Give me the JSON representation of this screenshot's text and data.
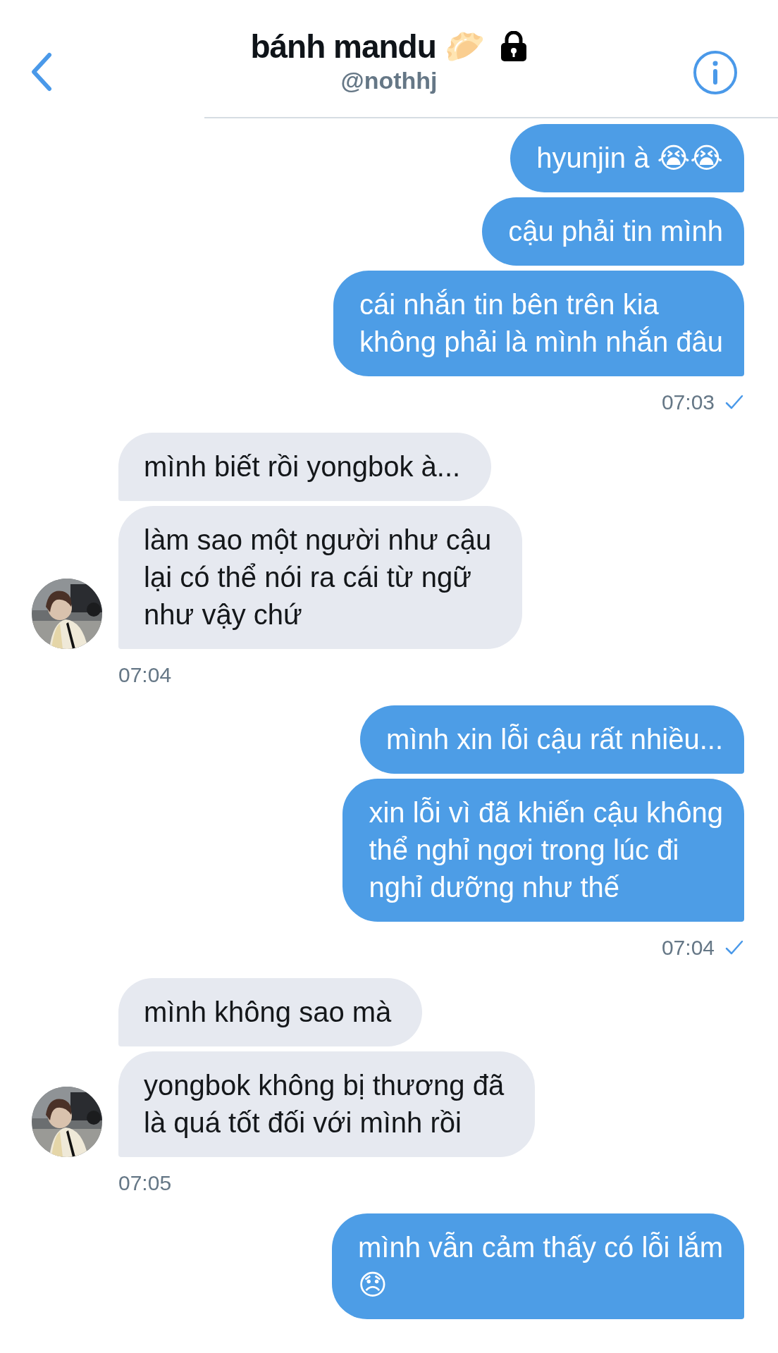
{
  "header": {
    "title": "bánh mandu 🥟",
    "locked": true,
    "handle": "@nothhj"
  },
  "groups": [
    {
      "kind": "sent",
      "messages": [
        "hyunjin à 😭😭",
        "cậu phải tin mình",
        "cái nhắn tin bên trên kia\nkhông phải là mình nhắn đâu"
      ],
      "time": "07:03",
      "read": true
    },
    {
      "kind": "received",
      "messages": [
        "mình biết rồi yongbok à...",
        "làm sao một người như cậu\nlại có thể nói ra cái từ ngữ\nnhư vậy chứ"
      ],
      "time": "07:04"
    },
    {
      "kind": "sent",
      "messages": [
        "mình xin lỗi cậu rất nhiều...",
        "xin lỗi vì đã khiến cậu không\nthể nghỉ ngơi trong lúc đi\nnghỉ dưỡng như thế"
      ],
      "time": "07:04",
      "read": true
    },
    {
      "kind": "received",
      "messages": [
        "mình không sao mà",
        "yongbok không bị thương đã\nlà quá tốt đối với mình rồi"
      ],
      "time": "07:05"
    },
    {
      "kind": "sent",
      "messages": [
        "mình vẫn cảm thấy có lỗi lắm\n😞"
      ]
    }
  ]
}
